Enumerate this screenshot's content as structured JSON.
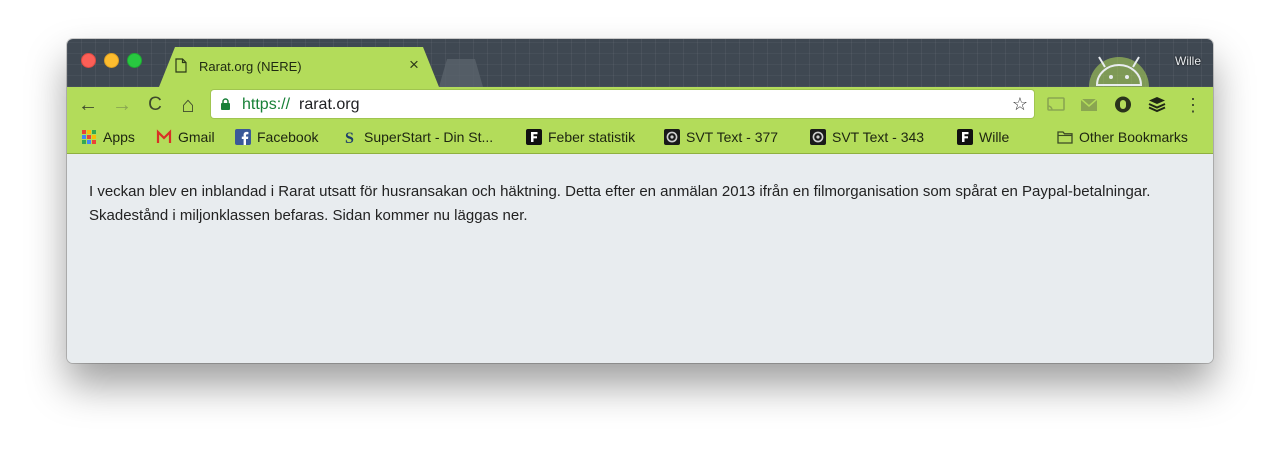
{
  "window": {
    "profile_name": "Wille"
  },
  "tab": {
    "title": "Rarat.org (NERE)",
    "close_glyph": "×"
  },
  "toolbar": {
    "back_glyph": "←",
    "forward_glyph": "→",
    "reload_glyph": "C",
    "home_glyph": "⌂",
    "url_scheme": "https://",
    "url_host": "rarat.org",
    "bookmark_star_glyph": "☆",
    "menu_glyph": "⋮",
    "extensions": [
      "cast-icon",
      "gmail-checker-icon",
      "ghostery-icon",
      "buffer-icon"
    ]
  },
  "bookmarks": {
    "items": [
      {
        "label": "Apps",
        "icon": "apps-grid-icon"
      },
      {
        "label": "Gmail",
        "icon": "gmail-icon"
      },
      {
        "label": "Facebook",
        "icon": "facebook-icon"
      },
      {
        "label": "SuperStart - Din St...",
        "icon": "superstart-icon"
      },
      {
        "label": "Feber statistik",
        "icon": "feber-icon"
      },
      {
        "label": "SVT Text - 377",
        "icon": "svt-icon"
      },
      {
        "label": "SVT Text - 343",
        "icon": "svt-icon"
      },
      {
        "label": "Wille",
        "icon": "feber-icon"
      }
    ],
    "other_label": "Other Bookmarks"
  },
  "page": {
    "message": "I veckan blev en inblandad i Rarat utsatt för husransakan och häktning. Detta efter en anmälan 2013 ifrån en filmorganisation som spårat en Paypal-betalningar. Skadestånd i miljonklassen befaras. Sidan kommer nu läggas ner."
  },
  "colors": {
    "theme_green": "#b3dc5a",
    "titlebar": "#3f4852",
    "page_bg": "#e8ecef",
    "url_scheme_green": "#188038"
  }
}
